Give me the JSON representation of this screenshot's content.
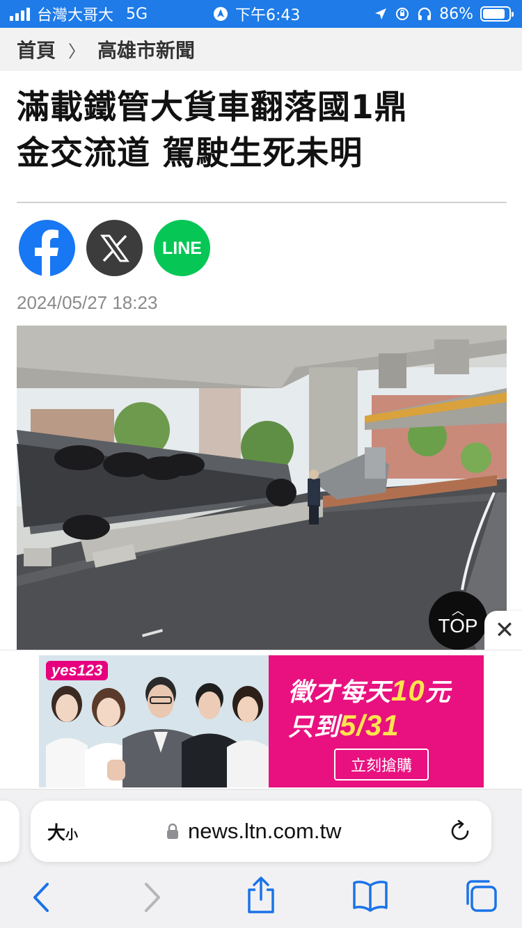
{
  "status_bar": {
    "carrier": "台灣大哥大",
    "network": "5G",
    "time": "下午6:43",
    "battery": "86%",
    "battery_level": 0.86
  },
  "breadcrumb": {
    "home": "首頁",
    "separator": "〉",
    "section": "高雄市新聞"
  },
  "article": {
    "headline_line1": "滿載鐵管大貨車翻落國1鼎",
    "headline_line2": "金交流道 駕駛生死未明",
    "date": "2024/05/27 18:23"
  },
  "share": {
    "line_label": "LINE"
  },
  "top_button": {
    "label": "TOP"
  },
  "ad": {
    "logo": "yes123",
    "line1_prefix": "徵才每天",
    "line1_number": "10",
    "line1_suffix": "元",
    "line2_prefix": "只到",
    "line2_number": "5/31",
    "cta": "立刻搶購",
    "close": "✕"
  },
  "browser": {
    "text_size_big": "大",
    "text_size_small": "小",
    "url": "news.ltn.com.tw"
  },
  "colors": {
    "status_bar": "#1e7be8",
    "facebook": "#1877f2",
    "line": "#06c755",
    "safari_blue": "#1a73e8",
    "ad_pink": "#e8117f"
  }
}
